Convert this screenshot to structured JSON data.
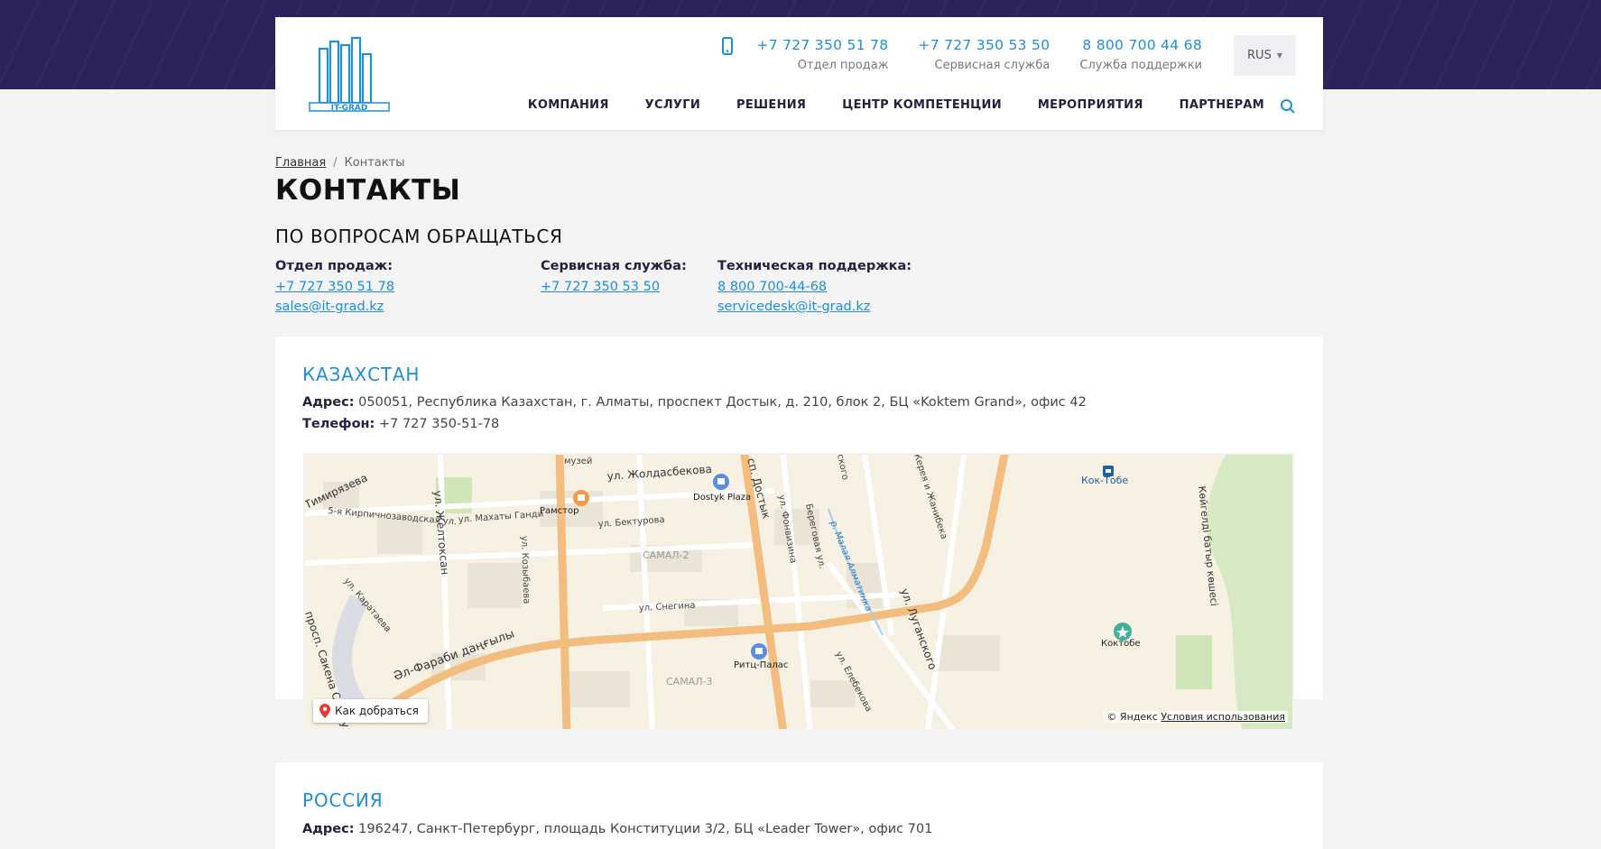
{
  "header": {
    "phones": [
      {
        "number": "+7 727 350 51 78",
        "caption": "Отдел продаж"
      },
      {
        "number": "+7 727 350 53 50",
        "caption": "Сервисная служба"
      },
      {
        "number": "8 800 700 44 68",
        "caption": "Служба поддержки"
      }
    ],
    "lang": "RUS",
    "logo_text": "IT-GRAD",
    "nav": [
      "КОМПАНИЯ",
      "УСЛУГИ",
      "РЕШЕНИЯ",
      "ЦЕНТР КОМПЕТЕНЦИИ",
      "МЕРОПРИЯТИЯ",
      "ПАРТНЕРАМ"
    ],
    "accent_color": "#1e8fd6",
    "band_color": "#2a2458"
  },
  "breadcrumb": {
    "home": "Главная",
    "sep": "/",
    "current": "Контакты"
  },
  "page_title": "КОНТАКТЫ",
  "section_title": "ПО ВОПРОСАМ ОБРАЩАТЬСЯ",
  "contacts": [
    {
      "label": "Отдел продаж:",
      "phone": "+7 727 350 51 78",
      "email": "sales@it-grad.kz"
    },
    {
      "label": "Сервисная служба:",
      "phone": "+7 727 350 53 50"
    },
    {
      "label": "Техническая поддержка:",
      "phone": "8 800 700-44-68",
      "email": "servicedesk@it-grad.kz"
    }
  ],
  "offices": {
    "kz": {
      "country": "КАЗАХСТАН",
      "address_label": "Адрес:",
      "address": "050051, Республика Казахстан, г. Алматы, проспект Достык, д. 210, блок 2, БЦ «Koktem Grand», офис 42",
      "phone_label": "Телефон:",
      "phone": "+7 727 350-51-78"
    },
    "ru": {
      "country": "РОССИЯ",
      "address_label": "Адрес:",
      "address": "196247, Санкт-Петербург, площадь Конституции 3/2, БЦ «Leader Tower», офис 701"
    }
  },
  "map": {
    "route_button": "Как добраться",
    "copyright": "© Яндекс",
    "terms": "Условия использования",
    "labels": {
      "museum": "музей",
      "zholdasbekov": "ул. Жолдасбекова",
      "dostyk_plaza": "Dostyk Plaza",
      "dostyk": "сп. Достык",
      "kok_tobe": "Кок-Тобе",
      "timiryazeva": "Тимирязева",
      "kirpich": "5-я Кирпичнозаводская ул.",
      "makhaty": "ул. Махаты Ганди",
      "ramstor": "Рамстор",
      "bekturova": "ул. Бектурова",
      "samal2": "САМАЛ-2",
      "zheltoksan": "ул. Желтоксан",
      "kozybaeva": "ул. Козыбаева",
      "fonvizina": "ул. Фонвизина",
      "beregovaya": "Береговая ул.",
      "malaya_almatinka": "р. Малая Алматинка",
      "luganskogo": "ул. Луганского",
      "kaplan": "ул. Каратаева",
      "snegina": "ул. Снегина",
      "koktobe": "Коктобе",
      "kokgeldi": "Көйгелді батыр көшесі",
      "al_farabi": "Әл-Фараби даңғылы",
      "ritz": "Ритц-Палас",
      "elebekova": "ул. Елебекова",
      "samal3": "САМАЛ-3",
      "seifullina": "просп. Сакена Сейфуллина",
      "kerey": "Керея и Жанибека",
      "skogo": "ского"
    }
  }
}
